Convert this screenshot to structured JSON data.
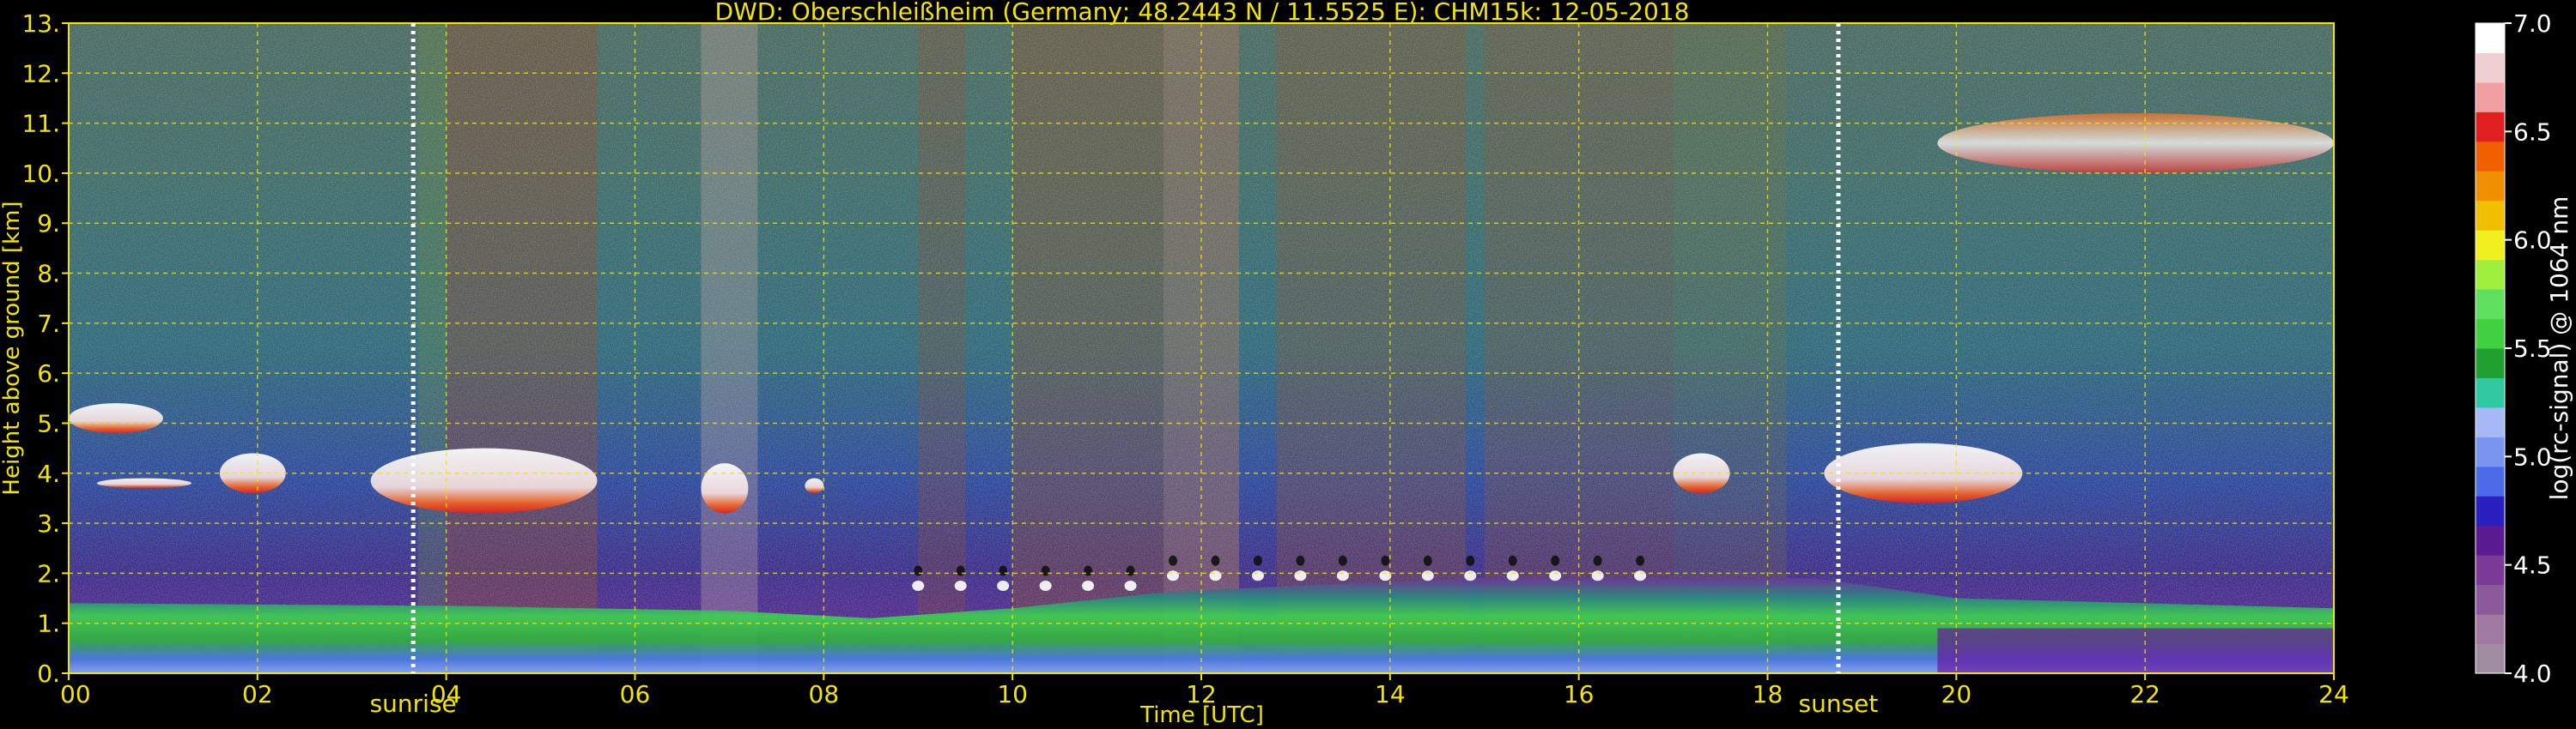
{
  "chart_data": {
    "type": "heatmap",
    "title": "DWD: Oberschleißheim (Germany; 48.2443 N / 11.5525 E):    CHM15k: 12-05-2018",
    "xlabel": "Time [UTC]",
    "ylabel": "Height above ground [km]",
    "xlim": [
      0,
      24
    ],
    "ylim": [
      0,
      13
    ],
    "x_ticks": [
      "00",
      "02",
      "04",
      "06",
      "08",
      "10",
      "12",
      "14",
      "16",
      "18",
      "20",
      "22",
      "24"
    ],
    "y_ticks": [
      "0.",
      "1.",
      "2.",
      "3.",
      "4.",
      "5.",
      "6.",
      "7.",
      "8.",
      "9.",
      "10.",
      "11.",
      "12.",
      "13."
    ],
    "grid": true,
    "markers": [
      {
        "label": "sunrise",
        "time": 3.65
      },
      {
        "label": "sunset",
        "time": 18.75
      }
    ],
    "colorbar": {
      "label": "log(rc-signal) @ 1064 nm",
      "range": [
        4.0,
        7.0
      ],
      "ticks": [
        "4.0",
        "4.5",
        "5.0",
        "5.5",
        "6.0",
        "6.5",
        "7.0"
      ],
      "colors": [
        "#a08ca0",
        "#a07aa0",
        "#8a5a9a",
        "#7a3a96",
        "#5a1a90",
        "#2a20c0",
        "#4a6ae8",
        "#7a96f0",
        "#a6b8f6",
        "#30c8a0",
        "#20a030",
        "#40d040",
        "#60e060",
        "#a0f040",
        "#f0f020",
        "#f0c000",
        "#f09000",
        "#f06000",
        "#e02020",
        "#f0a0a0",
        "#f0d0d0",
        "#ffffff"
      ]
    },
    "features": [
      {
        "name": "boundary layer",
        "x": [
          0,
          24
        ],
        "y": [
          0,
          1.8
        ]
      },
      {
        "name": "cloud",
        "x": [
          3.2,
          5.6
        ],
        "y": [
          3.2,
          4.5
        ]
      },
      {
        "name": "cloud",
        "x": [
          0,
          1.0
        ],
        "y": [
          4.8,
          5.4
        ]
      },
      {
        "name": "cloud",
        "x": [
          0.3,
          1.3
        ],
        "y": [
          3.7,
          3.9
        ]
      },
      {
        "name": "cloud",
        "x": [
          1.6,
          2.3
        ],
        "y": [
          3.6,
          4.4
        ]
      },
      {
        "name": "cloud",
        "x": [
          6.7,
          7.2
        ],
        "y": [
          3.2,
          4.2
        ]
      },
      {
        "name": "cloud",
        "x": [
          7.8,
          8.0
        ],
        "y": [
          3.6,
          3.9
        ]
      },
      {
        "name": "cloud",
        "x": [
          17.0,
          17.6
        ],
        "y": [
          3.6,
          4.4
        ]
      },
      {
        "name": "cloud",
        "x": [
          18.6,
          20.7
        ],
        "y": [
          3.4,
          4.6
        ]
      },
      {
        "name": "cirrus",
        "x": [
          19.8,
          24
        ],
        "y": [
          10.0,
          11.2
        ]
      }
    ]
  }
}
